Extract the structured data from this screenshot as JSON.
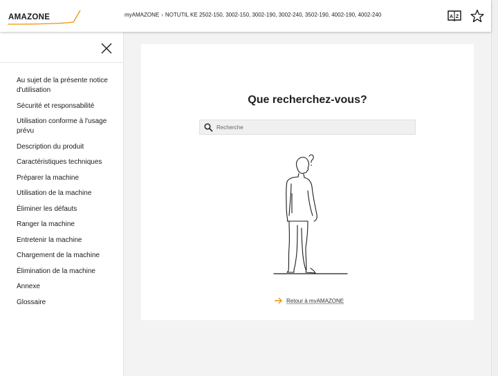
{
  "header": {
    "brand": "AMAZONE",
    "breadcrumb": [
      "myAMAZONE",
      "NOTUTIL KE 2502-150, 3002-150, 3002-190, 3002-240, 3502-190, 4002-190, 4002-240"
    ],
    "breadcrumb_separator": "›",
    "icons": [
      "dictionary-icon",
      "star-icon"
    ]
  },
  "sidebar": {
    "close_icon": "close-icon",
    "items": [
      "Au sujet de la présente notice d'utilisation",
      "Sécurité et responsabilité",
      "Utilisation conforme à l'usage prévu",
      "Description du produit",
      "Caractéristiques techniques",
      "Préparer la machine",
      "Utilisation de la machine",
      "Éliminer les défauts",
      "Ranger la machine",
      "Entretenir la machine",
      "Chargement de la machine",
      "Élimination de la machine",
      "Annexe",
      "Glossaire"
    ]
  },
  "main": {
    "title": "Que recherchez-vous?",
    "search": {
      "placeholder": "Recherche",
      "value": ""
    },
    "back_link": "Retour à myAMAZONE"
  },
  "colors": {
    "accent": "#f39200",
    "text": "#1f1f1f",
    "background": "#f3f3f3"
  }
}
